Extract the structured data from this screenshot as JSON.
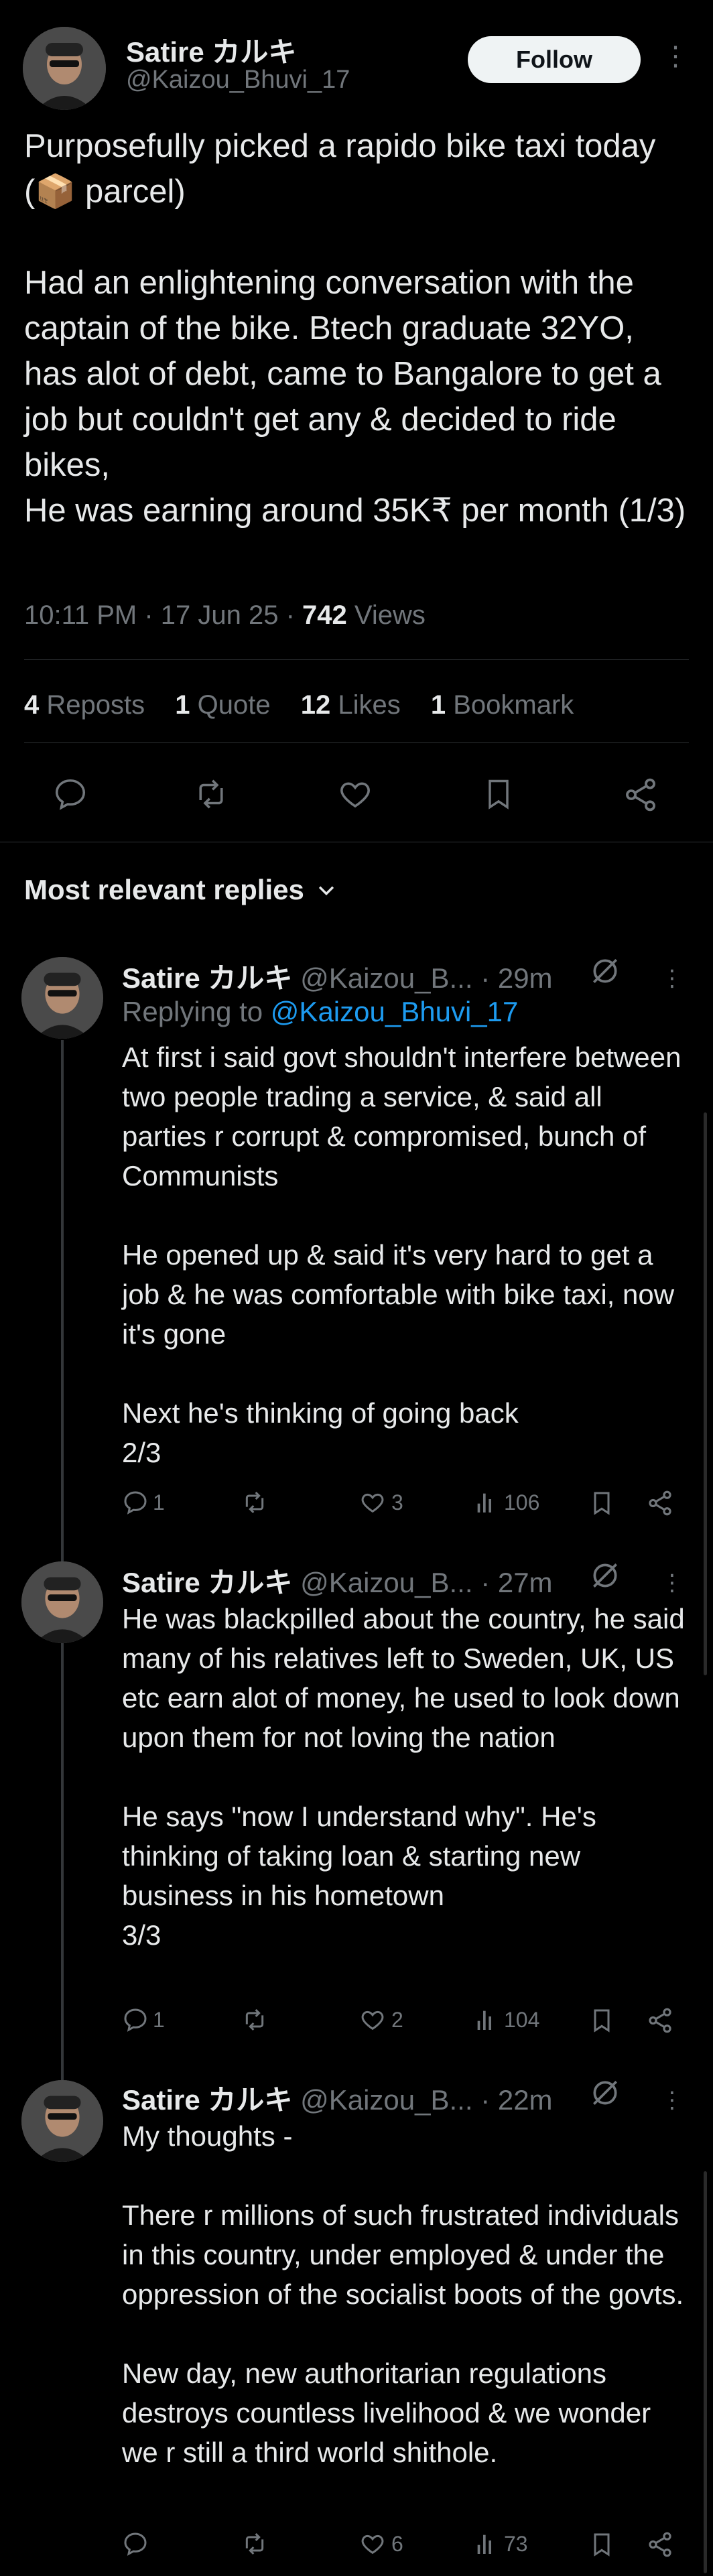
{
  "main_tweet": {
    "author_name": "Satire カルキ",
    "handle": "@Kaizou_Bhuvi_17",
    "follow_label": "Follow",
    "text": "Purposefully picked a rapido bike taxi today (📦 parcel)\n\nHad an enlightening conversation with the captain of the bike. Btech graduate 32YO, has alot of debt, came to Bangalore to get a job but couldn't get any & decided to ride bikes,\nHe was earning around 35K₹ per month (1/3)",
    "meta_time": "10:11 PM · 17 Jun 25 · ",
    "views_count": "742",
    "views_label": " Views",
    "stats": {
      "reposts_count": "4",
      "reposts_label": "Reposts",
      "quotes_count": "1",
      "quotes_label": "Quote",
      "likes_count": "12",
      "likes_label": "Likes",
      "bookmarks_count": "1",
      "bookmarks_label": "Bookmark"
    }
  },
  "replies_header": "Most relevant replies",
  "replies": [
    {
      "author_name": "Satire カルキ",
      "handle": "@Kaizou_B...",
      "time": "· 29m",
      "replying_prefix": "Replying to ",
      "replying_to": "@Kaizou_Bhuvi_17",
      "text": "At first i said govt shouldn't interfere between two people trading a service, & said all parties r corrupt & compromised, bunch of Communists\n\nHe opened up & said it's very hard to get a job & he was comfortable with bike taxi, now it's gone\n\nNext he's thinking of going back\n2/3",
      "replies_count": "1",
      "reposts_count": "",
      "likes_count": "3",
      "views_count": "106"
    },
    {
      "author_name": "Satire カルキ",
      "handle": "@Kaizou_B...",
      "time": "· 27m",
      "text": "He was blackpilled about the country, he said many of his relatives left to Sweden, UK, US etc earn alot of money, he used to look down upon them for not loving the nation\n\nHe says \"now I understand why\". He's thinking of taking loan & starting new business in his hometown\n3/3",
      "replies_count": "1",
      "reposts_count": "",
      "likes_count": "2",
      "views_count": "104"
    },
    {
      "author_name": "Satire カルキ",
      "handle": "@Kaizou_B...",
      "time": "· 22m",
      "text": "My thoughts -\n\nThere r millions of such frustrated individuals in this country, under employed & under the oppression of the socialist boots of the govts.\n\nNew day, new authoritarian regulations destroys countless livelihood & we wonder we r still a third world shithole.",
      "replies_count": "",
      "reposts_count": "",
      "likes_count": "6",
      "views_count": "73"
    }
  ],
  "colors": {
    "background": "#000000",
    "text": "#e7e9ea",
    "muted": "#71767b",
    "link": "#1d9bf0",
    "divider": "#2f3336"
  }
}
